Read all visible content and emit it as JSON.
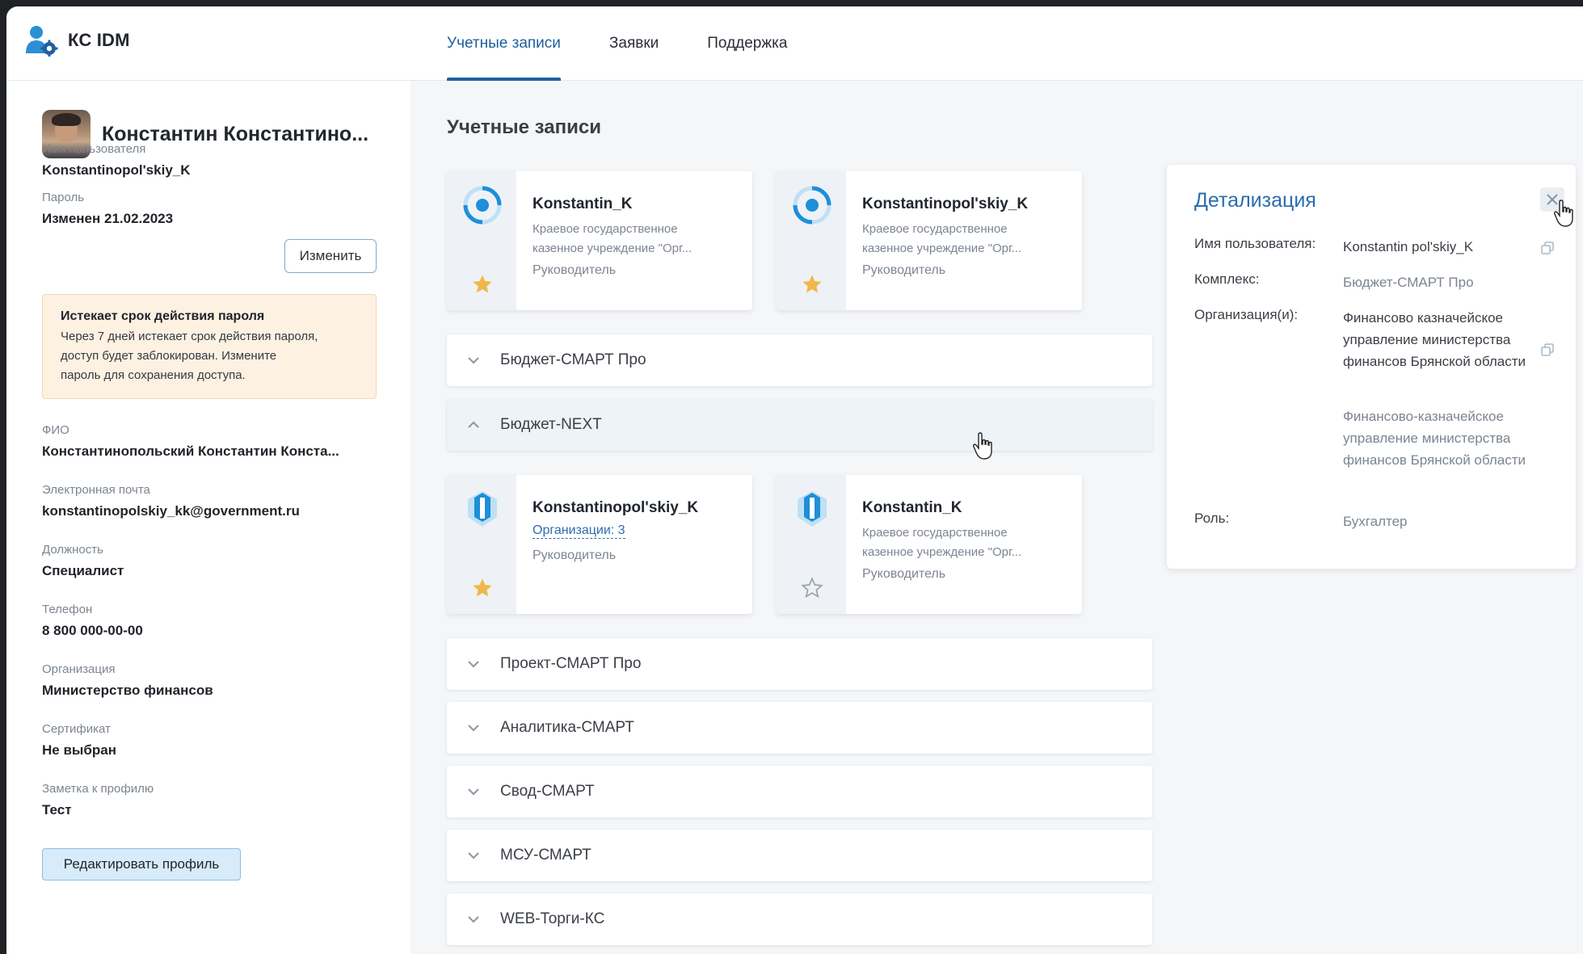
{
  "app": {
    "name": "КС IDM",
    "icon": "user-gear-icon"
  },
  "nav": {
    "tabs": [
      {
        "label": "Учетные записи",
        "active": true
      },
      {
        "label": "Заявки",
        "active": false
      },
      {
        "label": "Поддержка",
        "active": false
      }
    ]
  },
  "profile": {
    "name": "Константин Константино...",
    "username_label": "Имя пользователя",
    "username": "Konstantinopol'skiy_K",
    "password_label": "Пароль",
    "password_value": "Изменен 21.02.2023",
    "change_button": "Изменить",
    "warning": {
      "title": "Истекает срок действия пароля",
      "lines": [
        "Через 7 дней истекает срок действия пароля,",
        "доступ будет заблокирован. Измените",
        "пароль для сохранения доступа."
      ]
    },
    "fio_label": "ФИО",
    "fio": "Константинопольский Константин Конста...",
    "email_label": "Электронная почта",
    "email": "konstantinopolskiy_kk@government.ru",
    "position_label": "Должность",
    "position": "Специалист",
    "phone_label": "Телефон",
    "phone": "8 800 000-00-00",
    "org_label": "Организация",
    "org": "Министерство финансов",
    "cert_label": "Сертификат",
    "cert": "Не выбран",
    "note_label": "Заметка к профилю",
    "note": "Тест",
    "edit_button": "Редактировать профиль"
  },
  "main": {
    "title": "Учетные записи",
    "top_cards": [
      {
        "title": "Konstantin_K",
        "org1": "Краевое государственное",
        "org2": "казенное учреждение \"Орг...",
        "role": "Руководитель",
        "starred": true
      },
      {
        "title": "Konstantinopol'skiy_K",
        "org1": "Краевое государственное",
        "org2": "казенное учреждение \"Орг...",
        "role": "Руководитель",
        "starred": true
      }
    ],
    "sections": [
      {
        "label": "Бюджет-СМАРТ Про",
        "expanded": false
      },
      {
        "label": "Бюджет-NEXT",
        "expanded": true
      },
      {
        "label": "Проект-СМАРТ Про",
        "expanded": false
      },
      {
        "label": "Аналитика-СМАРТ",
        "expanded": false
      },
      {
        "label": "Свод-СМАРТ",
        "expanded": false
      },
      {
        "label": "МСУ-СМАРТ",
        "expanded": false
      },
      {
        "label": "WEB-Торги-КС",
        "expanded": false
      }
    ],
    "next_cards": [
      {
        "title": "Konstantinopol'skiy_K",
        "link": "Организации: 3",
        "role": "Руководитель",
        "starred": true
      },
      {
        "title": "Konstantin_K",
        "org1": "Краевое государственное",
        "org2": "казенное учреждение \"Орг...",
        "role": "Руководитель",
        "starred": false
      }
    ]
  },
  "details": {
    "title": "Детализация",
    "username_key": "Имя пользователя:",
    "username_val": "Konstantin  pol'skiy_K",
    "complex_key": "Комплекс:",
    "complex_val": "Бюджет-СМАРТ Про",
    "orgs_key": "Организация(и):",
    "org1": "Финансово казначейское управление министерства финансов Брянской области",
    "org2": "Финансово-казначейское управление министерства финансов Брянской области",
    "role_key": "Роль:",
    "role_val": "Бухгалтер"
  },
  "colors": {
    "accent": "#1f5f9e",
    "link": "#2c6cae",
    "star": "#f0b84a",
    "warning_bg": "#fdf1e2"
  }
}
